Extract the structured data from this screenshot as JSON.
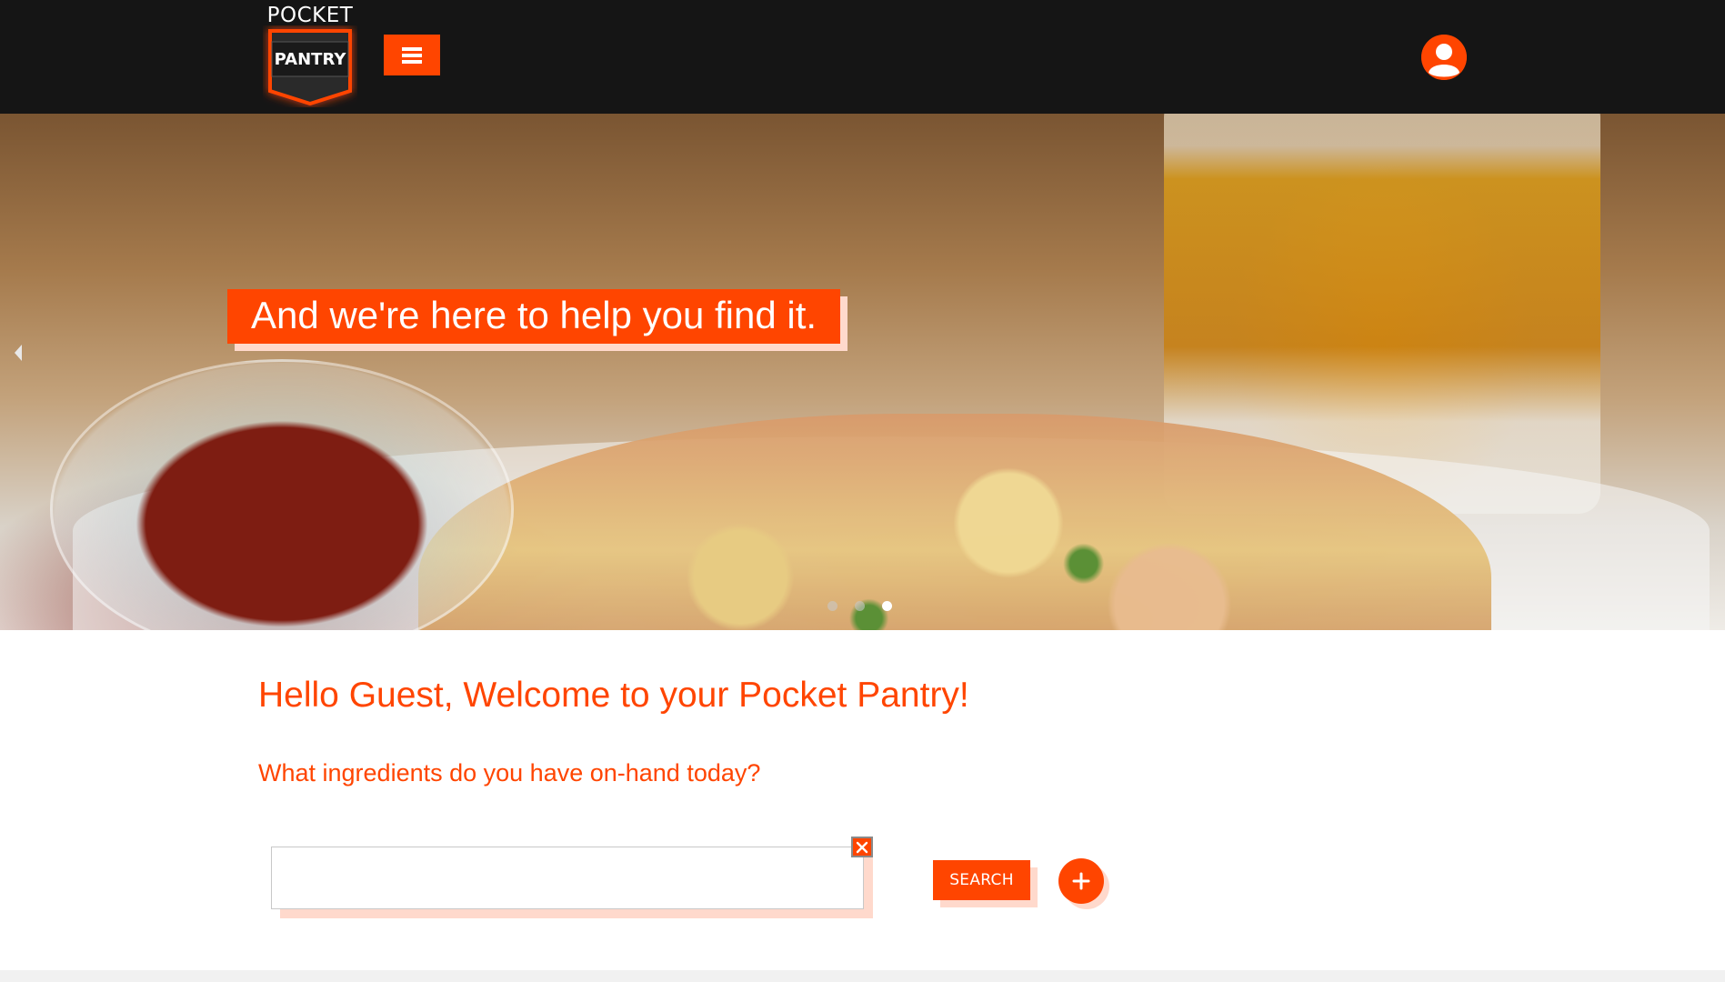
{
  "brand": {
    "logo_line1": "POCKET",
    "logo_line2": "PANTRY",
    "accent_color": "#ff4500",
    "topbar_color": "#151515"
  },
  "topbar": {
    "menu_icon": "hamburger-icon",
    "account_icon": "user-avatar-icon"
  },
  "hero": {
    "caption": "And we're here to help you find it.",
    "prev_icon": "caret-left-icon",
    "slide_count": 3,
    "active_slide": 3
  },
  "welcome": {
    "greeting": "Hello Guest, Welcome to your Pocket Pantry!",
    "question": "What ingredients do you have on-hand today?"
  },
  "search": {
    "value": "",
    "placeholder": "",
    "clear_icon": "close-icon",
    "button_label": "SEARCH",
    "add_icon": "plus-icon"
  }
}
